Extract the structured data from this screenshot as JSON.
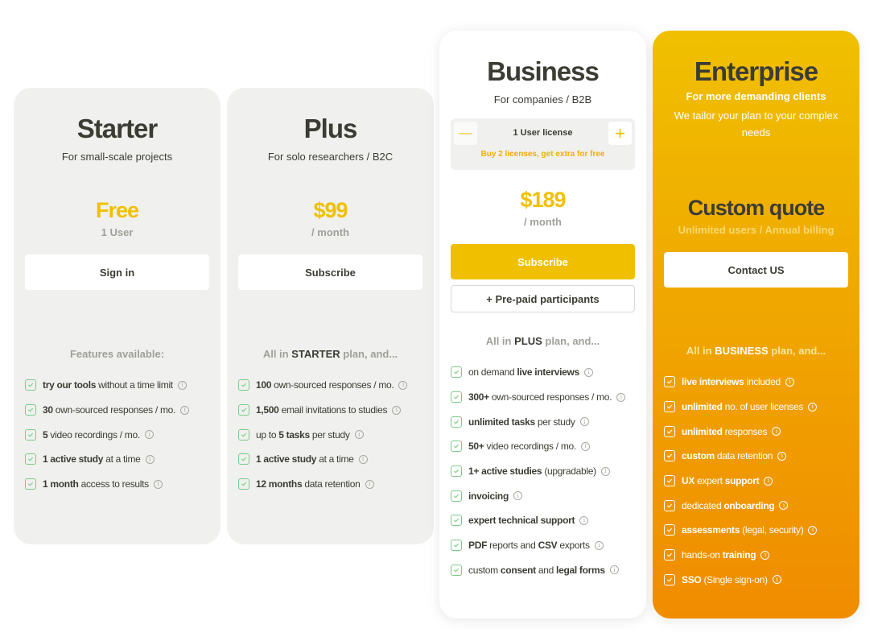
{
  "colors": {
    "accent": "#f0c000",
    "enterprise_gradient_top": "#f0c000",
    "enterprise_gradient_bottom": "#f08c00",
    "check_green": "#7ec98a",
    "card_bg": "#f0f0ee",
    "text_dark": "#3c3c35",
    "text_muted": "#a0a09a"
  },
  "plans": [
    {
      "name": "Starter",
      "subtitle": "For small-scale projects",
      "price": "Free",
      "price_note": "1 User",
      "cta_label": "Sign in",
      "features_title": {
        "prefix": "Features available:",
        "bold": "",
        "suffix": ""
      },
      "features": [
        {
          "pre": "",
          "bold": "try our tools",
          "post": " without a time limit"
        },
        {
          "pre": "",
          "bold": "30",
          "post": " own-sourced responses / mo."
        },
        {
          "pre": "",
          "bold": "5",
          "post": " video recordings / mo."
        },
        {
          "pre": "",
          "bold": "1 active study",
          "post": " at a time"
        },
        {
          "pre": "",
          "bold": "1 month",
          "post": " access to results"
        }
      ]
    },
    {
      "name": "Plus",
      "subtitle": "For solo researchers / B2C",
      "price": "$99",
      "price_note": "/ month",
      "cta_label": "Subscribe",
      "features_title": {
        "prefix": "All in ",
        "bold": "STARTER",
        "suffix": " plan, and..."
      },
      "features": [
        {
          "pre": "",
          "bold": "100",
          "post": " own-sourced responses / mo."
        },
        {
          "pre": "",
          "bold": "1,500",
          "post": " email invitations to studies"
        },
        {
          "pre": "up to ",
          "bold": "5 tasks",
          "post": " per study"
        },
        {
          "pre": "",
          "bold": "1 active study",
          "post": " at a time"
        },
        {
          "pre": "",
          "bold": "12 months",
          "post": " data retention"
        }
      ]
    },
    {
      "name": "Business",
      "subtitle": "For companies / B2B",
      "license": {
        "label": "1 User license",
        "promo": "Buy 2 licenses, get extra for free",
        "minus": "—",
        "plus": "+"
      },
      "price": "$189",
      "price_note": "/ month",
      "cta_label": "Subscribe",
      "secondary_label": "+ Pre-paid participants",
      "features_title": {
        "prefix": "All in ",
        "bold": "PLUS",
        "suffix": " plan, and..."
      },
      "features": [
        {
          "pre": "on demand ",
          "bold": "live interviews",
          "post": ""
        },
        {
          "pre": "",
          "bold": "300+",
          "post": " own-sourced responses / mo."
        },
        {
          "pre": "",
          "bold": "unlimited tasks",
          "post": " per study"
        },
        {
          "pre": "",
          "bold": "50+",
          "post": " video recordings / mo."
        },
        {
          "pre": "",
          "bold": "1+ active studies",
          "post": " (upgradable)"
        },
        {
          "pre": "",
          "bold": "invoicing",
          "post": ""
        },
        {
          "pre": "",
          "bold": "expert technical support",
          "post": ""
        },
        {
          "pre": "",
          "bold": "PDF",
          "post": " reports and ",
          "bold2": "CSV",
          "post2": " exports"
        },
        {
          "pre": "custom ",
          "bold": "consent",
          "post": " and ",
          "bold2": "legal forms",
          "post2": ""
        }
      ]
    },
    {
      "name": "Enterprise",
      "subtitle": "For more demanding clients",
      "subtitle2": "We tailor your plan to your complex needs",
      "price": "Custom quote",
      "price_note": "Unlimited users / Annual billing",
      "cta_label": "Contact US",
      "features_title": {
        "prefix": "All in ",
        "bold": "BUSINESS",
        "suffix": " plan, and..."
      },
      "features": [
        {
          "pre": "",
          "bold": "live interviews",
          "post": " included"
        },
        {
          "pre": "",
          "bold": "unlimited",
          "post": " no. of user licenses"
        },
        {
          "pre": "",
          "bold": "unlimited",
          "post": " responses"
        },
        {
          "pre": "",
          "bold": "custom",
          "post": " data retention"
        },
        {
          "pre": "",
          "bold": "UX",
          "post": " expert ",
          "bold2": "support",
          "post2": ""
        },
        {
          "pre": "dedicated ",
          "bold": "onboarding",
          "post": ""
        },
        {
          "pre": "",
          "bold": "assessments",
          "post": " (legal, security)"
        },
        {
          "pre": "hands-on ",
          "bold": "training",
          "post": ""
        },
        {
          "pre": "",
          "bold": "SSO",
          "post": " (Single sign-on)"
        }
      ]
    }
  ],
  "icons": {
    "check": "check-square-icon",
    "info": "info-circle-icon",
    "info_glyph": "i"
  }
}
